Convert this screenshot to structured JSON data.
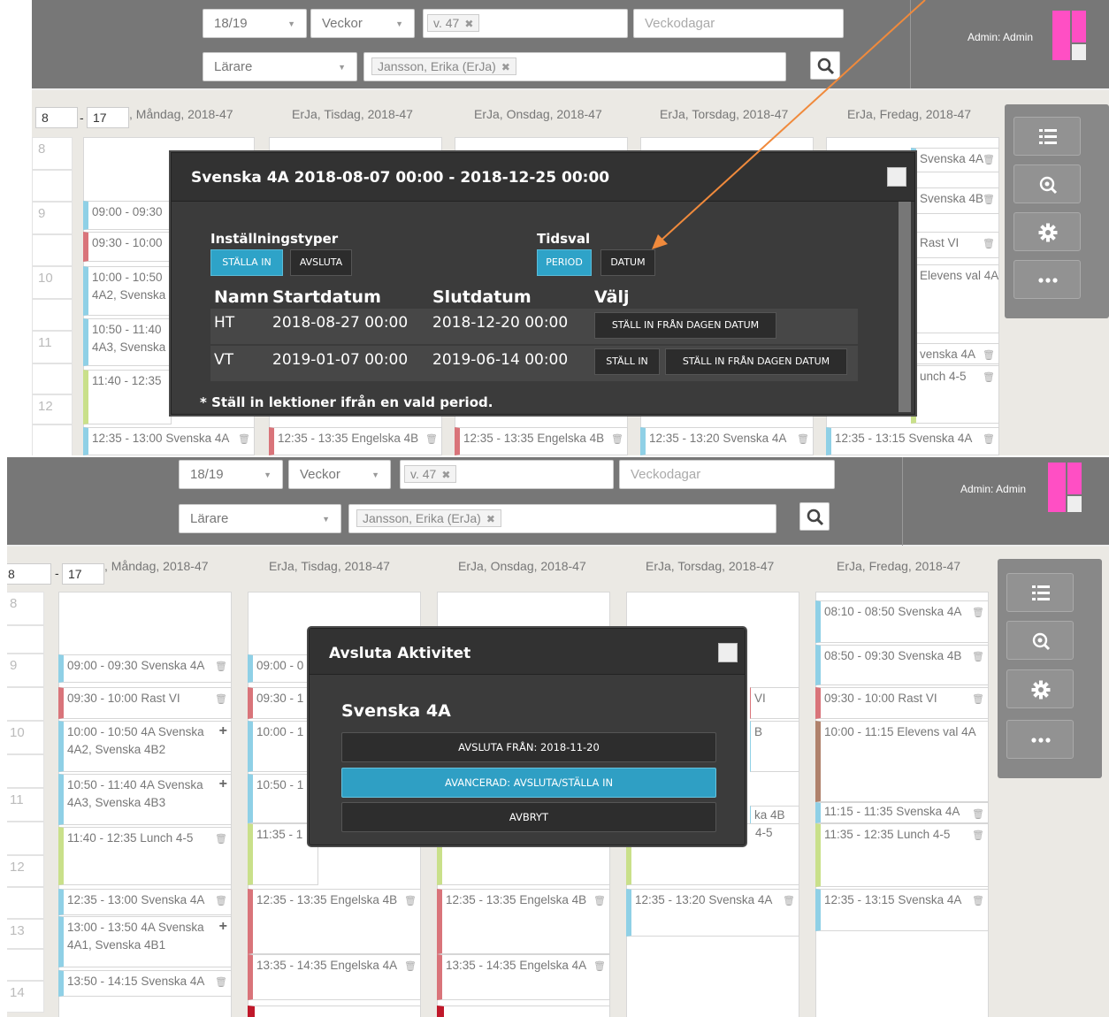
{
  "toolbar": {
    "year": "18/19",
    "period_type": "Veckor",
    "week_chip": "v. 47",
    "weekdays_placeholder": "Veckodagar",
    "role_type": "Lärare",
    "teacher_chip": "Jansson, Erika (ErJa)",
    "admin_label": "Admin: Admin"
  },
  "schedule": {
    "hour_from": "8",
    "hour_to_prefix": "-",
    "hour_to": "17",
    "days": [
      ", Måndag, 2018-47",
      "ErJa, Tisdag, 2018-47",
      "ErJa, Onsdag, 2018-47",
      "ErJa, Torsdag, 2018-47",
      "ErJa, Fredag, 2018-47"
    ],
    "hours": [
      "8",
      "9",
      "10",
      "11",
      "12",
      "13",
      "14"
    ]
  },
  "events_a": {
    "mon": [
      "09:00 - 09:30",
      "09:30 - 10:00",
      "10:00 - 10:50",
      "4A2, Svenska",
      "10:50 - 11:40",
      "4A3, Svenska",
      "11:40 - 12:35",
      "12:35 - 13:00 Svenska 4A"
    ],
    "tue": [
      "12:35 - 13:35 Engelska 4B"
    ],
    "wed": [
      "12:35 - 13:35 Engelska 4B"
    ],
    "thu": [
      "12:35 - 13:20 Svenska 4A"
    ],
    "fri": [
      "Svenska 4A",
      "Svenska 4B",
      "Rast VI",
      "Elevens val 4A",
      "venska 4A",
      "unch 4-5",
      "12:35 - 13:15 Svenska 4A"
    ]
  },
  "events_b": {
    "mon": [
      "09:00 - 09:30 Svenska 4A",
      "09:30 - 10:00 Rast VI",
      "10:00 - 10:50 4A Svenska",
      "4A2, Svenska 4B2",
      "10:50 - 11:40 4A Svenska",
      "4A3, Svenska 4B3",
      "11:40 - 12:35 Lunch 4-5",
      "12:35 - 13:00 Svenska 4A",
      "13:00 - 13:50 4A Svenska",
      "4A1, Svenska 4B1",
      "13:50 - 14:15 Svenska 4A"
    ],
    "tue": [
      "09:00 - 0",
      "09:30 - 1",
      "10:00 - 1",
      "10:50 - 1",
      "11:35 - 1",
      "12:35 - 13:35 Engelska 4B",
      "13:35 - 14:35 Engelska 4A"
    ],
    "wed": [
      "12:35 - 13:35 Engelska 4B",
      "13:35 - 14:35 Engelska 4A"
    ],
    "thu": [
      "VI",
      "B",
      "ka 4B",
      "4-5",
      "12:35 - 13:20 Svenska 4A"
    ],
    "fri": [
      "08:10 - 08:50 Svenska 4A",
      "08:50 - 09:30 Svenska 4B",
      "09:30 - 10:00 Rast VI",
      "10:00 - 11:15 Elevens val 4A",
      "11:15 - 11:35 Svenska 4A",
      "11:35 - 12:35 Lunch 4-5",
      "12:35 - 13:15 Svenska 4A"
    ]
  },
  "modal_settings": {
    "title": "Svenska 4A 2018-08-07 00:00 - 2018-12-25 00:00",
    "types_label": "Inställningstyper",
    "btn_stall_in": "STÄLLA IN",
    "btn_avsluta": "AVSLUTA",
    "time_label": "Tidsval",
    "btn_period": "PERIOD",
    "btn_datum": "DATUM",
    "headers": [
      "Namn",
      "Startdatum",
      "Slutdatum",
      "Välj"
    ],
    "rows": [
      {
        "name": "HT",
        "start": "2018-08-27 00:00",
        "end": "2018-12-20 00:00",
        "btn1": "STÄLL IN FRÅN DAGEN DATUM",
        "btn2": ""
      },
      {
        "name": "VT",
        "start": "2019-01-07 00:00",
        "end": "2019-06-14 00:00",
        "btn1": "STÄLL IN",
        "btn2": "STÄLL IN FRÅN DAGEN DATUM"
      }
    ],
    "footnote": "* Ställ in lektioner ifrån en vald period."
  },
  "modal_end": {
    "title": "Avsluta Aktivitet",
    "subtitle": "Svenska 4A",
    "btn_end_from": "AVSLUTA FRÅN: 2018-11-20",
    "btn_advanced": "AVANCERAD: AVSLUTA/STÄLLA IN",
    "btn_cancel": "AVBRYT"
  },
  "colors": {
    "accent": "#2ea3c8",
    "brand": "#ff4fc4",
    "arrow": "#f08a3c",
    "topbar": "#777777"
  },
  "icons": [
    "search-icon",
    "list-icon",
    "zoom-icon",
    "gear-icon",
    "more-icon",
    "close-icon",
    "trash-icon",
    "plus-icon"
  ]
}
